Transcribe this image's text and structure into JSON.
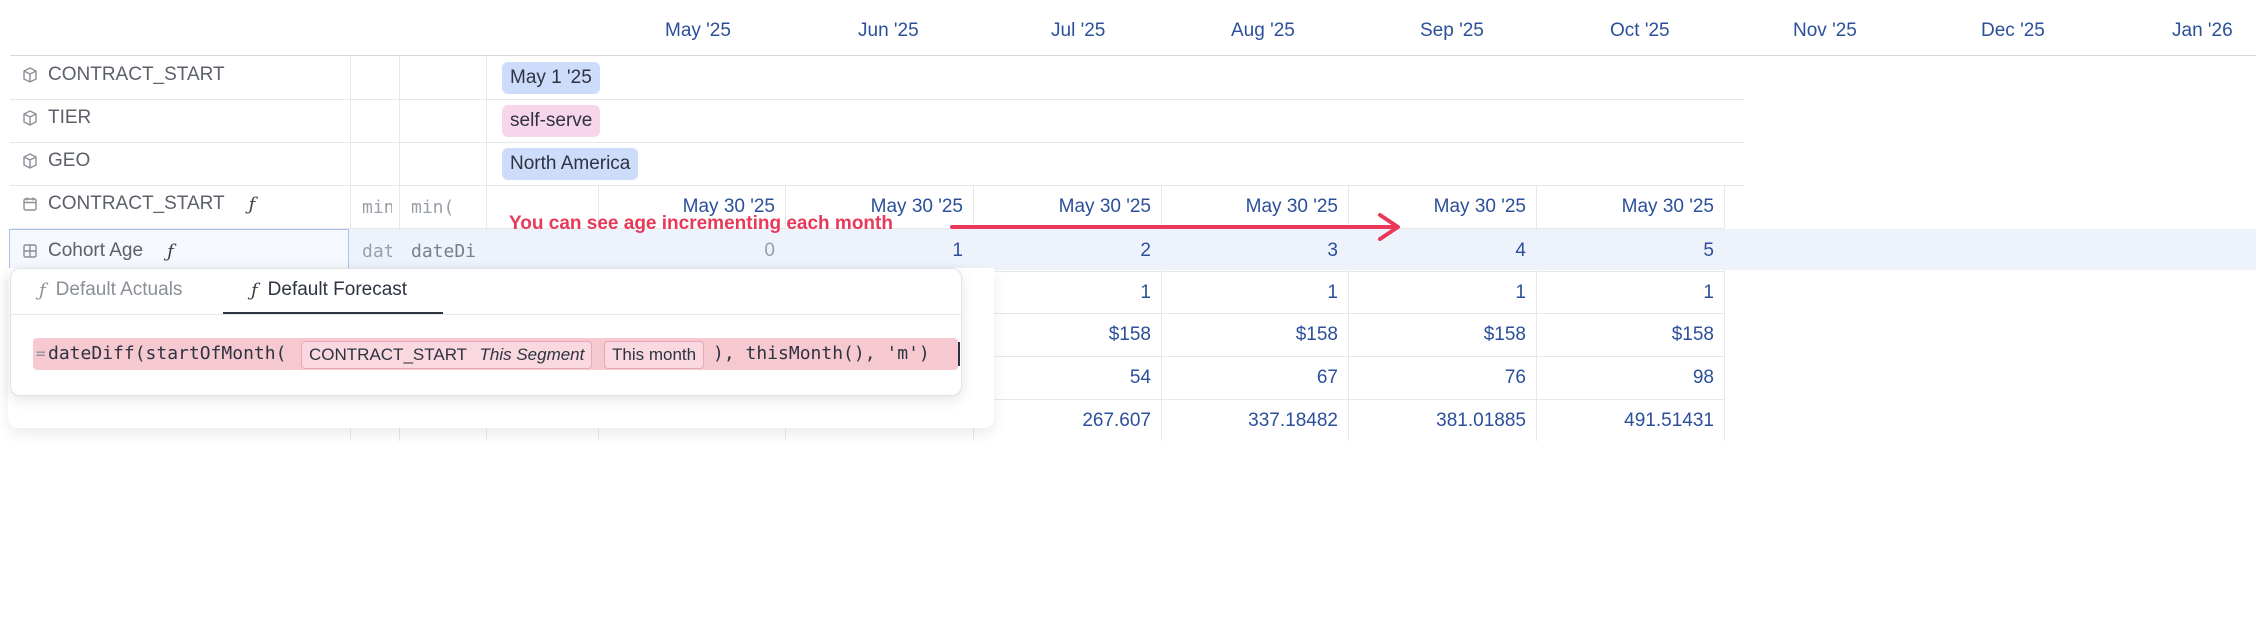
{
  "months": [
    "May '25",
    "Jun '25",
    "Jul '25",
    "Aug '25",
    "Sep '25",
    "Oct '25",
    "Nov '25",
    "Dec '25",
    "Jan '26"
  ],
  "rows": [
    {
      "label": "CONTRACT_START",
      "pill": "May 1 '25",
      "pill_color": "#cddcfb"
    },
    {
      "label": "TIER",
      "pill": "self-serve",
      "pill_color": "#f7d6ec"
    },
    {
      "label": "GEO",
      "pill": "North America",
      "pill_color": "#cddcfb"
    }
  ],
  "contract_row": {
    "label": "CONTRACT_START",
    "fx": "ƒ",
    "col1": "min",
    "col2": "min(",
    "values": [
      "May 30 '25",
      "May 30 '25",
      "May 30 '25",
      "May 30 '25",
      "May 30 '25",
      "May 30 '25"
    ]
  },
  "cohort_row": {
    "label": "Cohort Age",
    "fx": "ƒ",
    "col1": "dat",
    "col2": "dateDi",
    "values": [
      "0",
      "1",
      "2",
      "3",
      "4",
      "5"
    ]
  },
  "data_rows": [
    {
      "values": [
        "1",
        "1",
        "1",
        "1"
      ]
    },
    {
      "values": [
        "$158",
        "$158",
        "$158",
        "$158"
      ]
    },
    {
      "values": [
        "54",
        "67",
        "76",
        "98"
      ]
    },
    {
      "values": [
        "267.607",
        "337.18482",
        "381.01885",
        "491.51431"
      ]
    }
  ],
  "annotation": "You can see age incrementing each month",
  "annotation_color": "#e8395a",
  "popup": {
    "tabs": [
      {
        "label": "Default Actuals",
        "active": false
      },
      {
        "label": "Default Forecast",
        "active": true
      }
    ],
    "formula": {
      "eq": "=",
      "prefix": "dateDiff(startOfMonth(",
      "token_name": "CONTRACT_START",
      "token_segment": "This Segment",
      "token_time": "This month",
      "suffix": "), thisMonth(), 'm')"
    }
  },
  "colors": {
    "accent": "#2b4f9a",
    "selection": "#a8c1ee"
  }
}
